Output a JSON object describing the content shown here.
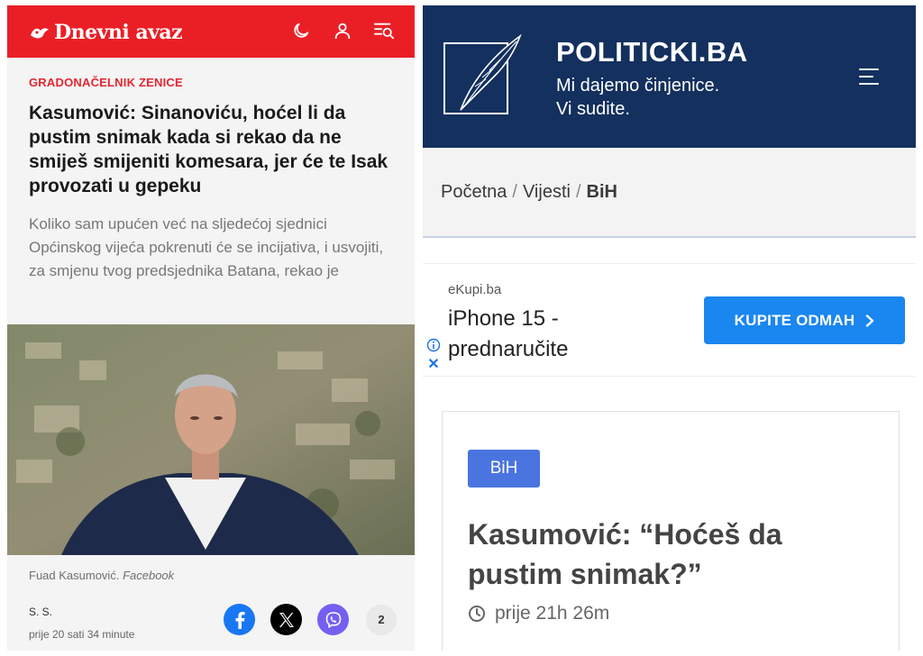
{
  "left": {
    "brand": "Dnevni avaz",
    "icons": [
      "moon-icon",
      "user-icon",
      "search-menu-icon"
    ],
    "kicker": "GRADONAČELNIK ZENICE",
    "headline": "Kasumović: Sinanoviću, hoćel li da pustim snimak kada si rekao da ne smiješ smijeniti komesara, jer će te Isak provozati u gepeku",
    "lead": "Koliko sam upućen već na sljedećoj sjednici Općinskog vijeća pokrenuti će se incijativa, i usvojiti, za smjenu tvog predsjednika Batana, rekao je",
    "caption_name": "Fuad Kasumović.",
    "caption_source": "Facebook",
    "author": "S. S.",
    "time": "prije 20 sati 34 minute",
    "share_count": "2",
    "colors": {
      "header": "#ea1f26",
      "kicker": "#e3262f"
    }
  },
  "right": {
    "brand": "POLITICKI.BA",
    "tagline_1": "Mi dajemo činjenice.",
    "tagline_2": "Vi sudite.",
    "breadcrumb": {
      "home": "Početna",
      "news": "Vijesti",
      "current": "BiH",
      "separator": "/"
    },
    "ad": {
      "source": "eKupi.ba",
      "title": "iPhone 15 - prednaručite",
      "cta": "KUPITE ODMAH",
      "close": "✕"
    },
    "article": {
      "badge": "BiH",
      "title": "Kasumović: “Hoćeš da pustim snimak?”",
      "time": "prije 21h 26m"
    },
    "colors": {
      "header": "#13305e",
      "cta": "#1a86f0",
      "badge": "#4a74e0"
    }
  }
}
